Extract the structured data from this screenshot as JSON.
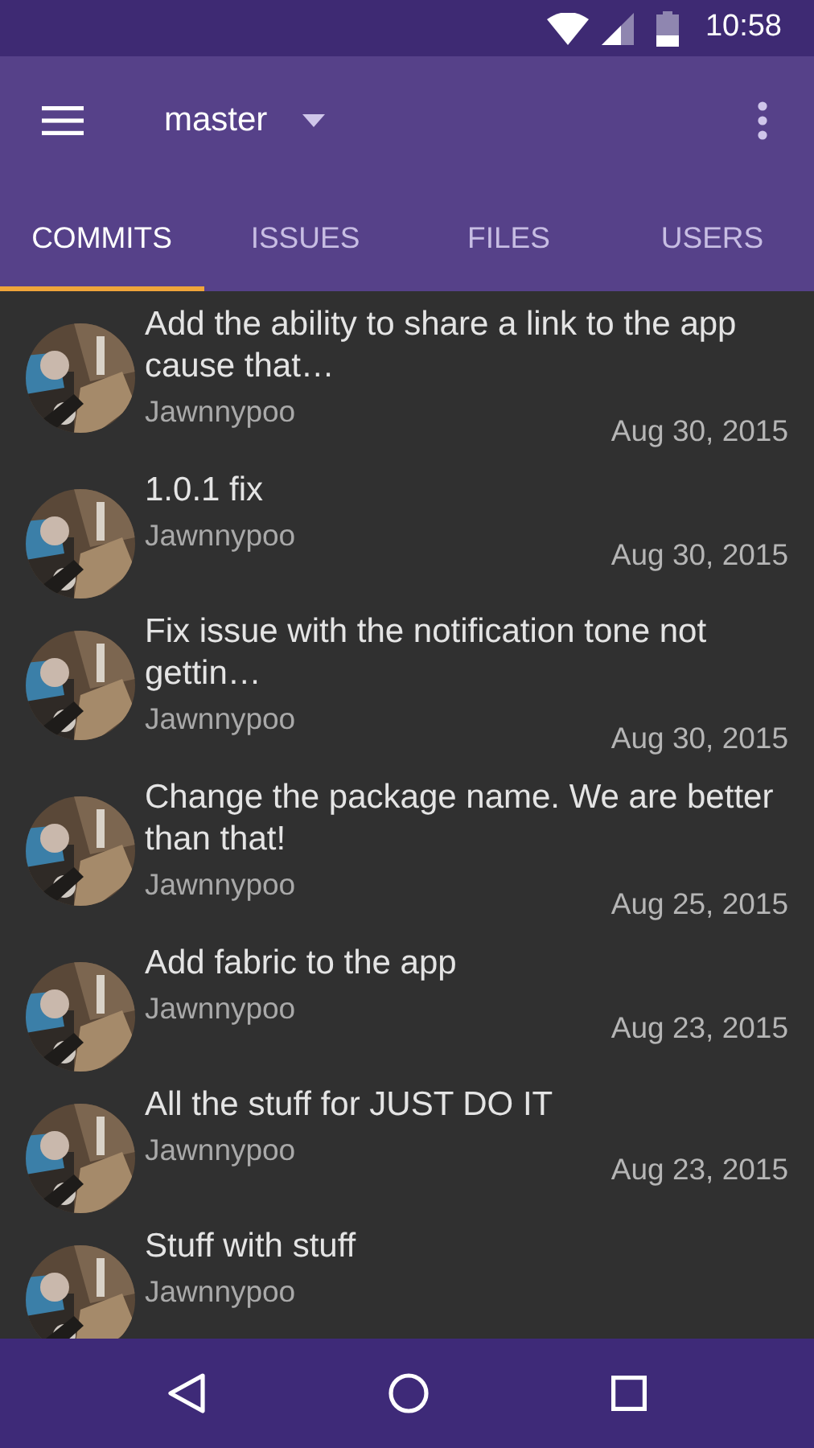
{
  "status_bar": {
    "time": "10:58"
  },
  "toolbar": {
    "branch": "master"
  },
  "tabs": [
    {
      "label": "COMMITS",
      "selected": true
    },
    {
      "label": "ISSUES",
      "selected": false
    },
    {
      "label": "FILES",
      "selected": false
    },
    {
      "label": "USERS",
      "selected": false
    }
  ],
  "commits": [
    {
      "message": "Add the ability to share a link to the app cause that…",
      "author": "Jawnnypoo",
      "date": "Aug 30, 2015"
    },
    {
      "message": "1.0.1 fix",
      "author": "Jawnnypoo",
      "date": "Aug 30, 2015"
    },
    {
      "message": "Fix issue with the notification tone not gettin…",
      "author": "Jawnnypoo",
      "date": "Aug 30, 2015"
    },
    {
      "message": "Change the package name. We are better than that!",
      "author": "Jawnnypoo",
      "date": "Aug 25, 2015"
    },
    {
      "message": "Add fabric to the app",
      "author": "Jawnnypoo",
      "date": "Aug 23, 2015"
    },
    {
      "message": "All the stuff for JUST DO IT",
      "author": "Jawnnypoo",
      "date": "Aug 23, 2015"
    },
    {
      "message": "Stuff with stuff",
      "author": "Jawnnypoo"
    }
  ]
}
